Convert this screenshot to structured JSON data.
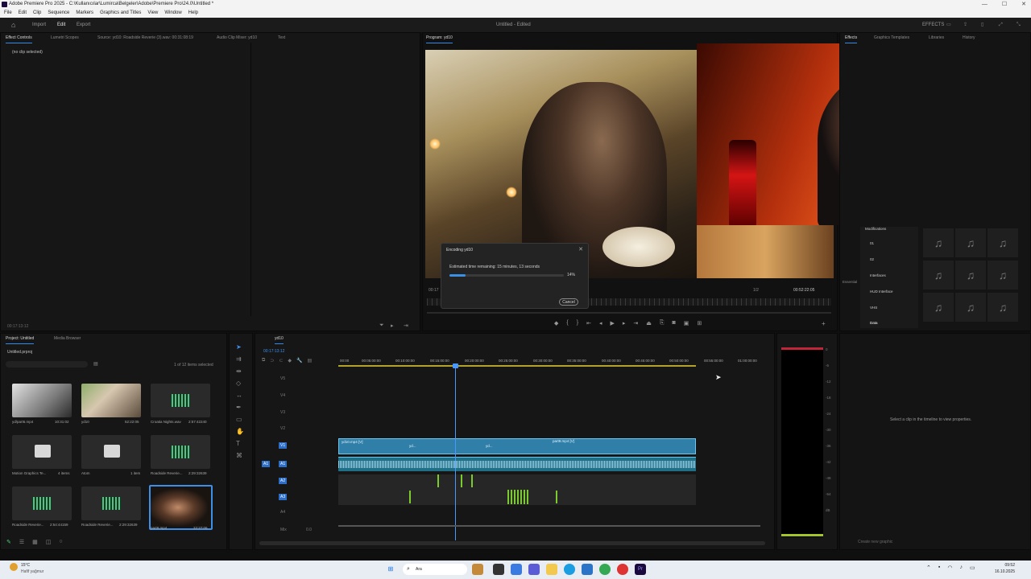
{
  "titlebar": {
    "title": "Adobe Premiere Pro 2025 - C:\\Kullanıcılar\\Lumirca\\Belgeler\\Adobe\\Premiere Pro\\24.0\\Untitled *",
    "min": "—",
    "max": "☐",
    "close": "✕"
  },
  "menu": [
    "File",
    "Edit",
    "Clip",
    "Sequence",
    "Markers",
    "Graphics and Titles",
    "View",
    "Window",
    "Help"
  ],
  "workspace": {
    "tabs": [
      "Import",
      "Edit",
      "Export"
    ],
    "active": "Edit",
    "doc_title": "Untitled - Edited",
    "effects_label": "EFFECTS"
  },
  "effect_controls": {
    "tabs": [
      "Effect Controls",
      "Lumetri Scopes",
      "Source: yd10: Roadside Reverie (3).wav: 00:31:08:19",
      "Audio Clip Mixer: yd10",
      "Text"
    ],
    "no_clip": "(no clip selected)",
    "timecode": "00:17:13:12"
  },
  "program": {
    "title": "Program: yd10",
    "tc_left": "00:17",
    "tc_right": "00:52:22:05",
    "zoom": "1/2"
  },
  "encode": {
    "title": "Encoding yd10",
    "remaining": "Estimated time remaining: 15 minutes, 13 seconds",
    "percent": "14%",
    "progress": 0.14,
    "cancel": "Cancel"
  },
  "right_panel": {
    "tabs": [
      "Effects",
      "Graphics Templates",
      "Libraries",
      "History"
    ],
    "essential": "Essential",
    "tree": [
      "Modifications",
      "01",
      "02",
      "Interfaces",
      "HUD Interface",
      "VHS",
      "Data"
    ],
    "ec_hint": "Select a clip in the timeline to view properties.",
    "create_graphic": "Create new graphic"
  },
  "project": {
    "tabs": [
      "Project: Untitled",
      "Media Browser"
    ],
    "file": "Untitled.prproj",
    "selected": "1 of 12 items selected",
    "items": [
      {
        "name": "yd/part6.mp4",
        "dur": "10:31:02"
      },
      {
        "name": "yd10",
        "dur": "52:22:05"
      },
      {
        "name": "Croatia Nights.wav",
        "dur": "2:57:42240"
      },
      {
        "name": "Motion Graphics Te...",
        "dur": "4 items"
      },
      {
        "name": "Atom",
        "dur": "1 item"
      },
      {
        "name": "Roadside Reverie...",
        "dur": "2:29:32639"
      },
      {
        "name": "Roadside Reverie...",
        "dur": "2:54:44159"
      },
      {
        "name": "Roadside Reverie...",
        "dur": "2:29:32639"
      },
      {
        "name": "part9.mp4",
        "dur": "22:27:06"
      }
    ]
  },
  "timeline": {
    "title": "yd10",
    "timecode": "00:17:13:12",
    "ruler": [
      "00:00",
      "00:05:00:00",
      "00:10:00:00",
      "00:15:00:00",
      "00:20:00:00",
      "00:25:00:00",
      "00:30:00:00",
      "00:35:00:00",
      "00:40:00:00",
      "00:45:00:00",
      "00:50:00:00",
      "00:55:00:00",
      "01:00:00:00"
    ],
    "tracks": [
      "V5",
      "V4",
      "V3",
      "V2",
      "V1",
      "A1",
      "A2",
      "A3",
      "A4",
      "Mix"
    ],
    "mix_value": "0.0",
    "clips": [
      "yd10.mp4 [V]",
      "yd...",
      "yd...",
      "part9.mp4 [V]"
    ]
  },
  "meter_scale": [
    "0",
    "-6",
    "-12",
    "-18",
    "-24",
    "-30",
    "-36",
    "-42",
    "-48",
    "-54",
    "dB"
  ],
  "taskbar": {
    "weather_temp": "15°C",
    "weather_desc": "Hafif yağmur",
    "search": "Ara",
    "time": "09:52",
    "date": "16.10.2025"
  }
}
